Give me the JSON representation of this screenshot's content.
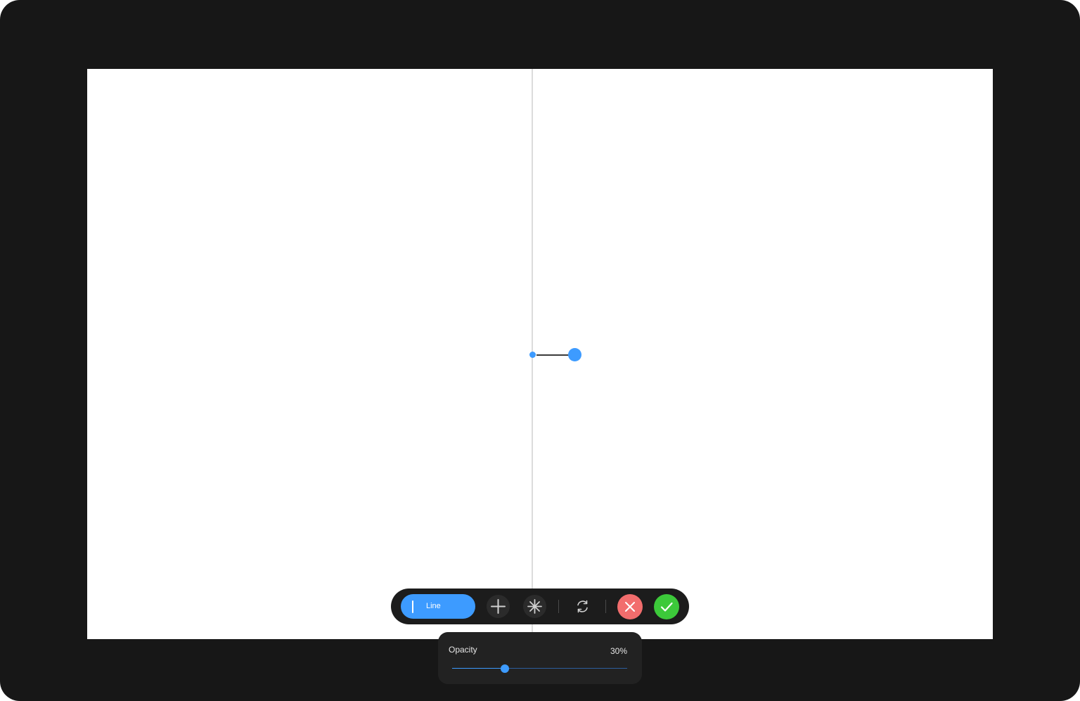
{
  "toolbar": {
    "line_label": "Line",
    "icons": {
      "add": "plus-icon",
      "sparkle": "sparkle-icon",
      "rotate": "rotate-icon",
      "cancel": "close-icon",
      "confirm": "check-icon"
    }
  },
  "opacity": {
    "label": "Opacity",
    "value_text": "30%",
    "value": 0.3
  },
  "colors": {
    "accent": "#3d9bff",
    "cancel": "#f26d6d",
    "confirm": "#3cc93a",
    "frame": "#171717"
  }
}
